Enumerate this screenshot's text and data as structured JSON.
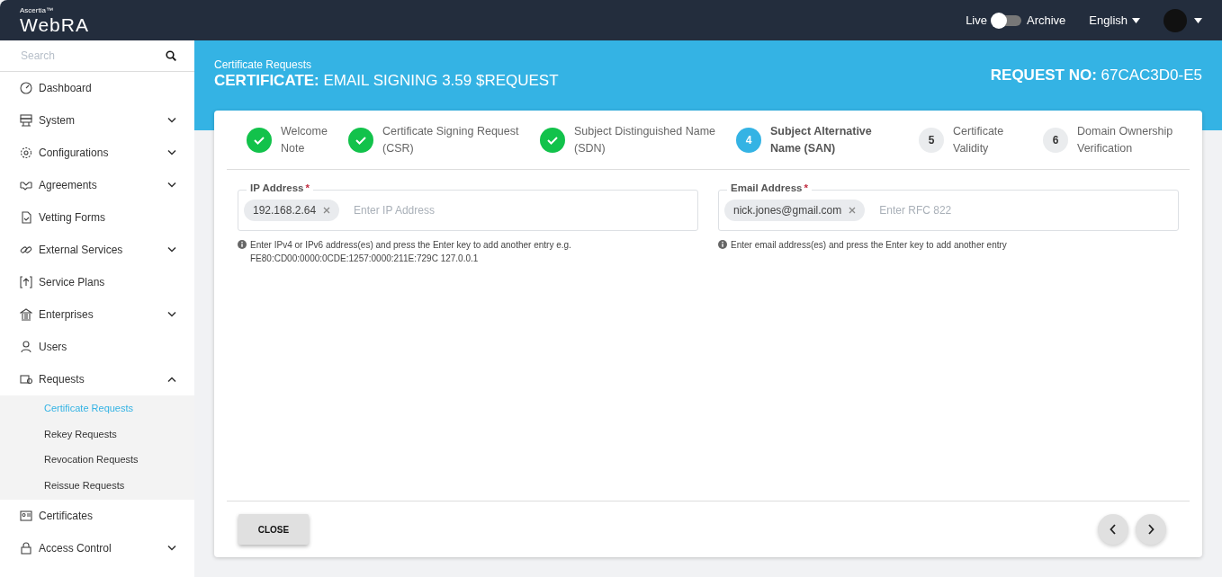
{
  "header": {
    "brand_small": "Ascertia™",
    "brand": "WebRA",
    "toggle": {
      "left_label": "Live",
      "right_label": "Archive",
      "on": false
    },
    "language": "English"
  },
  "sidebar": {
    "search_placeholder": "Search",
    "items": [
      {
        "label": "Dashboard"
      },
      {
        "label": "System",
        "expanded": false
      },
      {
        "label": "Configurations",
        "expanded": false
      },
      {
        "label": "Agreements",
        "expanded": false
      },
      {
        "label": "Vetting Forms"
      },
      {
        "label": "External Services",
        "expanded": false
      },
      {
        "label": "Service Plans"
      },
      {
        "label": "Enterprises",
        "expanded": false
      },
      {
        "label": "Users"
      },
      {
        "label": "Requests",
        "expanded": true,
        "children": [
          {
            "label": "Certificate Requests",
            "selected": true
          },
          {
            "label": "Rekey Requests",
            "selected": false
          },
          {
            "label": "Revocation Requests",
            "selected": false
          },
          {
            "label": "Reissue Requests",
            "selected": false
          }
        ]
      },
      {
        "label": "Certificates"
      },
      {
        "label": "Access Control",
        "expanded": false
      }
    ]
  },
  "banner": {
    "breadcrumb": "Certificate Requests",
    "title": "**CERTIFICATE:** EMAIL SIGNING 3.59 $REQUEST",
    "request_no": "**REQUEST NO:** 67CAC3D0-E5"
  },
  "steps": [
    {
      "label": "Welcome Note",
      "completed": true,
      "selected": false
    },
    {
      "label": "Certificate Signing Request (CSR)",
      "completed": true,
      "selected": false
    },
    {
      "label": "Subject Distinguished Name (SDN)",
      "completed": true,
      "selected": false
    },
    {
      "number": "4",
      "label": "Subject Alternative Name (SAN)",
      "completed": false,
      "selected": true
    },
    {
      "number": "5",
      "label": "Certificate Validity",
      "completed": false,
      "selected": false
    },
    {
      "number": "6",
      "label": "Domain Ownership Verification",
      "completed": false,
      "selected": false
    }
  ],
  "fields": [
    {
      "label": "IP Address",
      "required_mark": "*",
      "chips": [
        "192.168.2.64"
      ],
      "placeholder": "Enter IP Address",
      "hint": "Enter IPv4 or IPv6 address(es) and press the Enter key to add another entry e.g.",
      "hint_example": "FE80:CD00:0000:0CDE:1257:0000:211E:729C 127.0.0.1"
    },
    {
      "label": "Email Address",
      "required_mark": "*",
      "chips": [
        "nick.jones@gmail.com"
      ],
      "placeholder": "Enter RFC 822",
      "hint": "Enter email address(es) and press the Enter key to add another entry"
    }
  ],
  "footer": {
    "close": "CLOSE"
  }
}
